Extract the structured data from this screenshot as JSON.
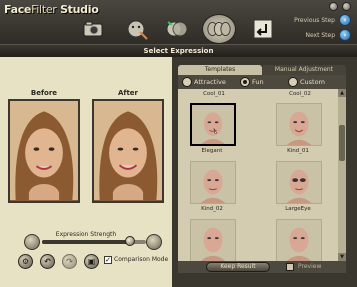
{
  "app": {
    "title_part1": "Face",
    "title_part2": "Filter",
    "title_part3": "Studio"
  },
  "toolbar": {
    "icons": [
      "camera-icon",
      "face-tools-icon",
      "face-morph-icon",
      "expression-faces-icon",
      "back-arrow-icon"
    ],
    "previous_step": "Previous Step",
    "next_step": "Next Step"
  },
  "header": {
    "title": "Select Expression"
  },
  "photos": {
    "before_label": "Before",
    "after_label": "After"
  },
  "expression": {
    "label": "Expression Strength",
    "value": 0.85
  },
  "comparison": {
    "label": "Comparison Mode",
    "checked": true,
    "mark": "✓"
  },
  "templates": {
    "tabs": [
      "Templates",
      "Manual Adjustment"
    ],
    "filters": [
      {
        "label": "Attractive",
        "selected": false
      },
      {
        "label": "Fun",
        "selected": true
      },
      {
        "label": "Custom",
        "selected": false
      }
    ],
    "header_labels": [
      "Cool_01",
      "Cool_02"
    ],
    "items": [
      "Elegant",
      "Kind_01",
      "Kind_02",
      "LargeEye"
    ],
    "keep_result": "Keep Result",
    "preview_label": "Preview"
  }
}
